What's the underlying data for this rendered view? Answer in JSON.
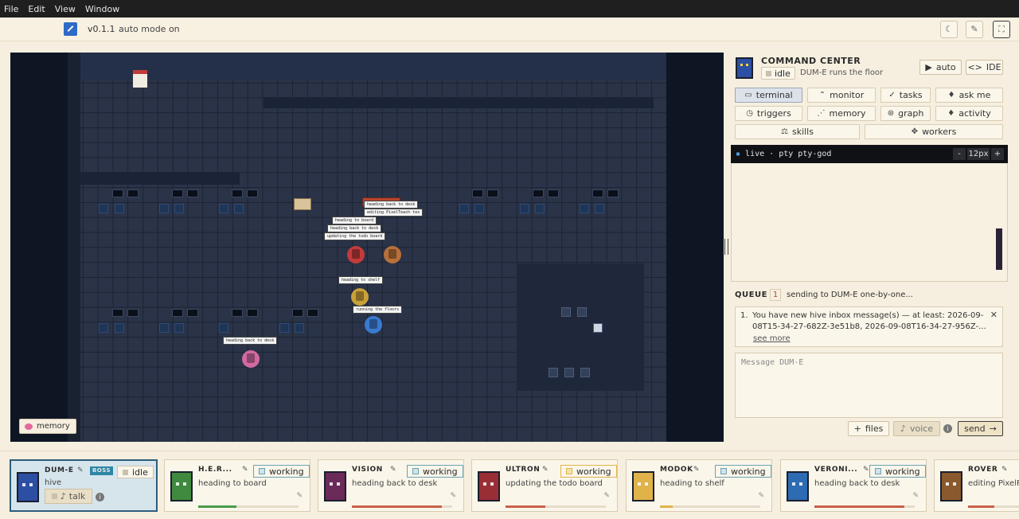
{
  "menu": [
    "File",
    "Edit",
    "View",
    "Window"
  ],
  "toolbar": {
    "version": "v0.1.1",
    "mode": "auto mode on",
    "buttons": [
      "moon-icon",
      "wrench-icon",
      "fullscreen-icon"
    ]
  },
  "game": {
    "memory_chip": "memory",
    "bubbles": [
      "heading back to desk",
      "editing PixelTeach tex",
      "heading to board",
      "heading back to desk",
      "updating the todo board",
      "heading to shelf",
      "running the floors",
      "heading back to desk"
    ]
  },
  "panel": {
    "title": "COMMAND CENTER",
    "status": "idle",
    "subtitle": "DUM-E runs the floor",
    "auto_btn": "auto",
    "ide_btn": "IDE",
    "tabs": [
      {
        "label": "terminal",
        "icon": "terminal-icon",
        "active": true
      },
      {
        "label": "monitor",
        "icon": "monitor-icon",
        "active": false
      },
      {
        "label": "tasks",
        "icon": "check-icon",
        "active": false
      },
      {
        "label": "ask me",
        "icon": "bell-icon",
        "active": false
      },
      {
        "label": "triggers",
        "icon": "clock-icon",
        "active": false
      },
      {
        "label": "memory",
        "icon": "memory-icon",
        "active": false
      },
      {
        "label": "graph",
        "icon": "graph-icon",
        "active": false
      },
      {
        "label": "activity",
        "icon": "bell-icon",
        "active": false
      },
      {
        "label": "skills",
        "icon": "skills-icon",
        "active": false
      },
      {
        "label": "workers",
        "icon": "workers-icon",
        "active": false
      }
    ],
    "terminal": {
      "title_live": "live",
      "title_rest": " · pty pty-god",
      "font_size": "12px",
      "minus": "-",
      "plus": "+"
    },
    "queue": {
      "title": "QUEUE",
      "count": "1",
      "status": "sending to DUM-E one-by-one...",
      "item_num": "1.",
      "item_text": "You have new hive inbox message(s) — at least: 2026-09-08T15-34-27-682Z-3e51b8, 2026-09-08T16-34-27-956Z-...",
      "see_more": "see more"
    },
    "message_placeholder": "Message DUM-E",
    "files_btn": "files",
    "voice_btn": "voice",
    "send_btn": "send"
  },
  "roster": [
    {
      "name": "DUM-E",
      "boss": "BOSS",
      "status": "idle",
      "task": "hive",
      "talk": "talk",
      "color": "#2d4fa3",
      "progress": 0
    },
    {
      "name": "H.E.R...",
      "status": "working",
      "task": "heading to board",
      "color": "#3f8a3f",
      "bar_color": "#4a9a4a",
      "progress": 0.38
    },
    {
      "name": "VISION",
      "status": "working",
      "task": "heading back to desk",
      "color": "#6b2a5a",
      "bar_color": "#c9604a",
      "progress": 0.9
    },
    {
      "name": "ULTRON",
      "status": "working",
      "task": "updating the todo board",
      "color": "#9a2e36",
      "bar_color": "#c9604a",
      "progress": 0.4,
      "warn": true
    },
    {
      "name": "MODOK",
      "status": "working",
      "task": "heading to shelf",
      "color": "#e0b24a",
      "bar_color": "#e0b24a",
      "progress": 0.13
    },
    {
      "name": "VERONI...",
      "status": "working",
      "task": "heading back to desk",
      "color": "#2d6bb3",
      "bar_color": "#c9604a",
      "progress": 0.9
    },
    {
      "name": "ROVER",
      "status": "",
      "task": "editing PixelPa",
      "color": "#8a5a2e",
      "bar_color": "#c9604a",
      "progress": 0.5
    }
  ]
}
